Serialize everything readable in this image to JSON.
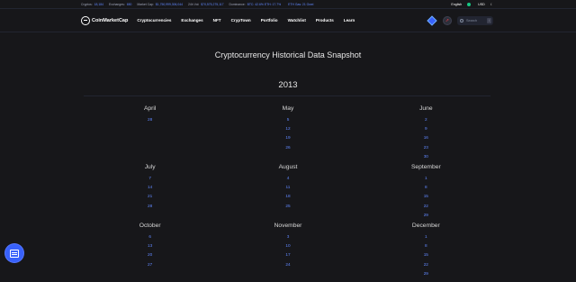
{
  "topbar": {
    "stats": [
      {
        "label": "Cryptos:",
        "value": "18,184",
        "green": ""
      },
      {
        "label": "Exchanges:",
        "value": "650",
        "green": ""
      },
      {
        "label": "Market Cap:",
        "value": "$1,750,999,306,044",
        "green": ""
      },
      {
        "label": "24h Vol:",
        "value": "$70,575,275,117",
        "green": ""
      },
      {
        "label": "Dominance:",
        "value": "BTC: 42.6% ETH: 17.7%",
        "green": ""
      },
      {
        "label": "",
        "value": "",
        "green": ""
      }
    ],
    "gas": "ETH Gas: 21 Gwei",
    "language": "English",
    "currency": "USD"
  },
  "nav": {
    "brand": "CoinMarketCap",
    "items": [
      "Cryptocurrencies",
      "Exchanges",
      "NFT",
      "CrypTown",
      "Portfolio",
      "Watchlist",
      "Products",
      "Learn"
    ],
    "search_placeholder": "Search",
    "search_shortcut": "/"
  },
  "page": {
    "title": "Cryptocurrency Historical Data Snapshot",
    "year": "2013"
  },
  "months": [
    {
      "name": "April",
      "days": [
        "28"
      ]
    },
    {
      "name": "May",
      "days": [
        "5",
        "12",
        "19",
        "26"
      ]
    },
    {
      "name": "June",
      "days": [
        "2",
        "9",
        "16",
        "23",
        "30"
      ]
    },
    {
      "name": "July",
      "days": [
        "7",
        "14",
        "21",
        "28"
      ]
    },
    {
      "name": "August",
      "days": [
        "4",
        "11",
        "18",
        "25"
      ]
    },
    {
      "name": "September",
      "days": [
        "1",
        "8",
        "15",
        "22",
        "29"
      ]
    },
    {
      "name": "October",
      "days": [
        "6",
        "13",
        "20",
        "27"
      ]
    },
    {
      "name": "November",
      "days": [
        "3",
        "10",
        "17",
        "24"
      ]
    },
    {
      "name": "December",
      "days": [
        "1",
        "8",
        "15",
        "22",
        "29"
      ]
    }
  ],
  "colors": {
    "accent": "#6188ff",
    "background": "#17171a",
    "brand": "#3861fb"
  },
  "icons": {
    "fab": "feedback-icon",
    "theme": "moon-icon",
    "search": "search-icon"
  }
}
